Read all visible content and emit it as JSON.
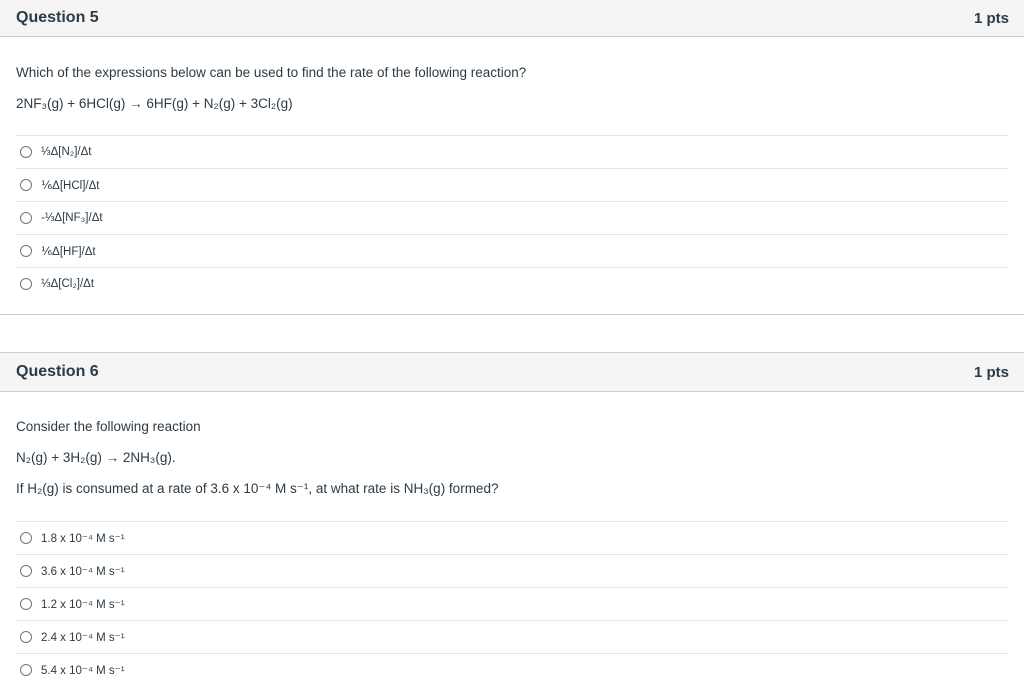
{
  "q5": {
    "title": "Question 5",
    "points": "1 pts",
    "prompt": "Which of the expressions below can be used to find the rate of the following reaction?",
    "equation": "2NF₃(g) + 6HCl(g) → 6HF(g) + N₂(g) + 3Cl₂(g)",
    "answers": [
      "⅓Δ[N₂]/Δt",
      "⅙Δ[HCl]/Δt",
      "-⅓Δ[NF₃]/Δt",
      "⅙Δ[HF]/Δt",
      "⅓Δ[Cl₂]/Δt"
    ]
  },
  "q6": {
    "title": "Question 6",
    "points": "1 pts",
    "prompt": "Consider the following reaction",
    "equation": "N₂(g) + 3H₂(g) → 2NH₃(g).",
    "question": "If H₂(g) is consumed at a rate of 3.6 x 10⁻⁴ M s⁻¹, at what rate is NH₃(g) formed?",
    "answers": [
      "1.8 x 10⁻⁴ M s⁻¹",
      "3.6 x 10⁻⁴ M s⁻¹",
      "1.2 x 10⁻⁴ M s⁻¹",
      "2.4 x 10⁻⁴ M s⁻¹",
      "5.4 x 10⁻⁴ M s⁻¹"
    ]
  }
}
